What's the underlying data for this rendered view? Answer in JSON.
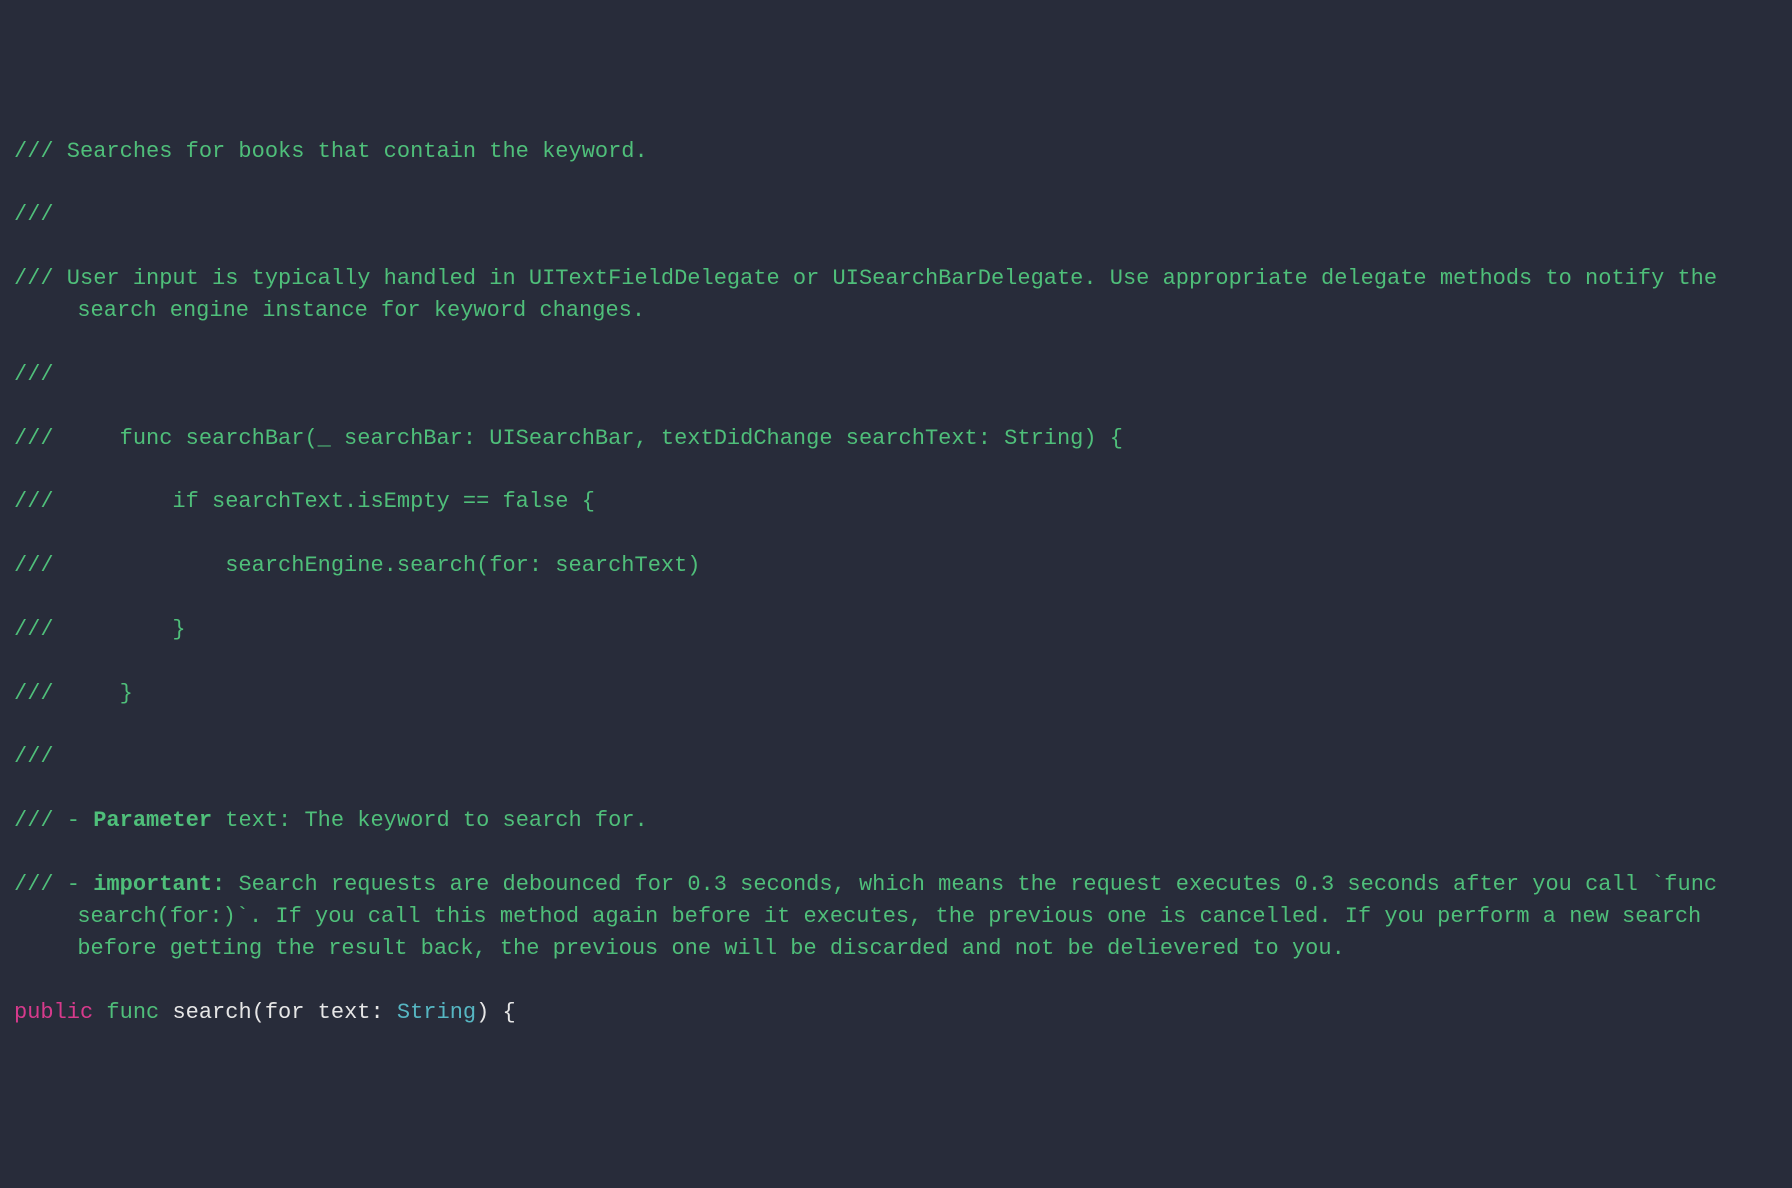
{
  "doc": {
    "prefix": "///",
    "line1": "/// Searches for books that contain the keyword.",
    "line2": "///",
    "line3": "/// User input is typically handled in UITextFieldDelegate or UISearchBarDelegate. Use appropriate delegate methods to notify the search engine instance for keyword changes.",
    "line4": "///",
    "line5": "///     func searchBar(_ searchBar: UISearchBar, textDidChange searchText: String) {",
    "line6": "///         if searchText.isEmpty == false {",
    "line7": "///             searchEngine.search(for: searchText)",
    "line8": "///         }",
    "line9": "///     }",
    "line10": "///",
    "line11_pre": "/// - ",
    "line11_bold": "Parameter",
    "line11_post": " text: The keyword to search for.",
    "line12_pre": "/// - ",
    "line12_bold": "important:",
    "line12_post": " Search requests are debounced for 0.3 seconds, which means the request executes 0.3 seconds after you call `func search(for:)`. If you call this method again before it executes, the previous one is cancelled. If you perform a new search before getting the result back, the previous one will be discarded and not be delievered to you."
  },
  "decl": {
    "public": "public",
    "func": "func",
    "name": "search",
    "open_paren": "(",
    "for": "for",
    "space": " ",
    "param": "text",
    "colon": ": ",
    "type": "String",
    "close": ") {"
  }
}
